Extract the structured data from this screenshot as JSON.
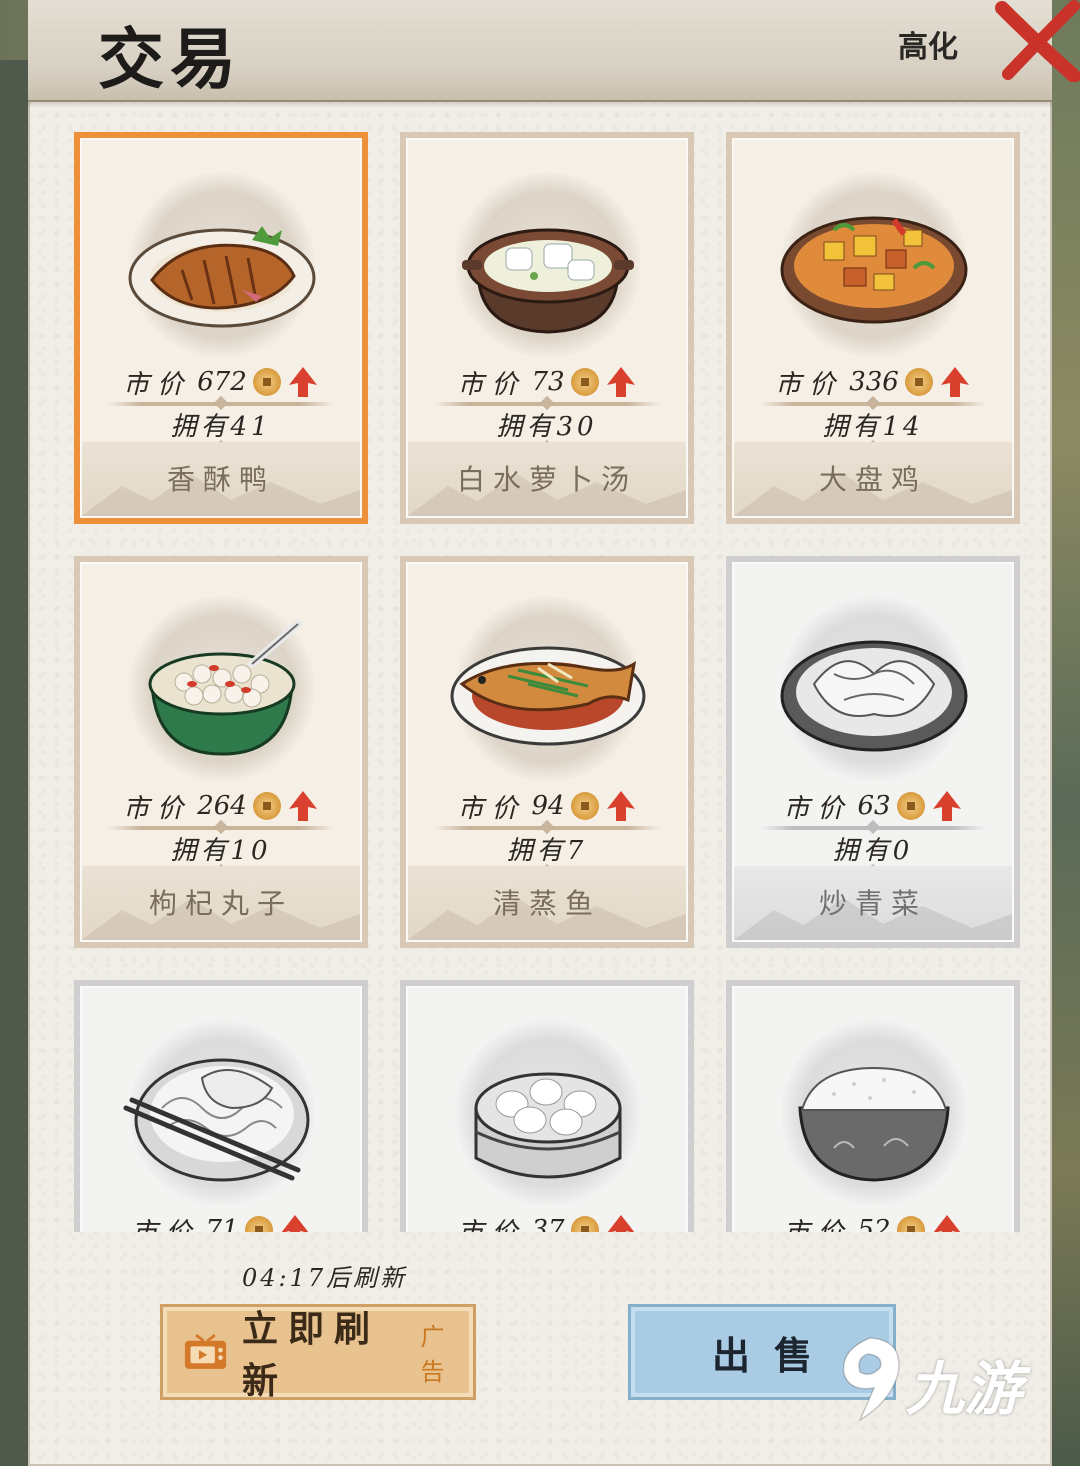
{
  "window": {
    "title": "交易",
    "side_text": "高化"
  },
  "labels": {
    "price": "市价",
    "own": "拥有"
  },
  "items": [
    {
      "name": "香酥鸭",
      "price": "672",
      "own": "41",
      "state": "selected"
    },
    {
      "name": "白水萝卜汤",
      "price": "73",
      "own": "30",
      "state": "normal"
    },
    {
      "name": "大盘鸡",
      "price": "336",
      "own": "14",
      "state": "normal"
    },
    {
      "name": "枸杞丸子",
      "price": "264",
      "own": "10",
      "state": "normal"
    },
    {
      "name": "清蒸鱼",
      "price": "94",
      "own": "7",
      "state": "normal"
    },
    {
      "name": "炒青菜",
      "price": "63",
      "own": "0",
      "state": "locked"
    },
    {
      "name": "",
      "price": "71",
      "own": "",
      "state": "locked"
    },
    {
      "name": "",
      "price": "37",
      "own": "",
      "state": "locked"
    },
    {
      "name": "",
      "price": "52",
      "own": "",
      "state": "locked"
    }
  ],
  "footer": {
    "timer": "04:17后刷新",
    "refresh_label": "立即刷新",
    "ad_label": "广告",
    "sell_label": "出售"
  },
  "watermark": {
    "text": "九游"
  },
  "colors": {
    "selected_border": "#ee8f3a",
    "price_arrow": "#d9402e",
    "sell_button": "#a9cbe3",
    "refresh_button": "#e9c38f"
  }
}
